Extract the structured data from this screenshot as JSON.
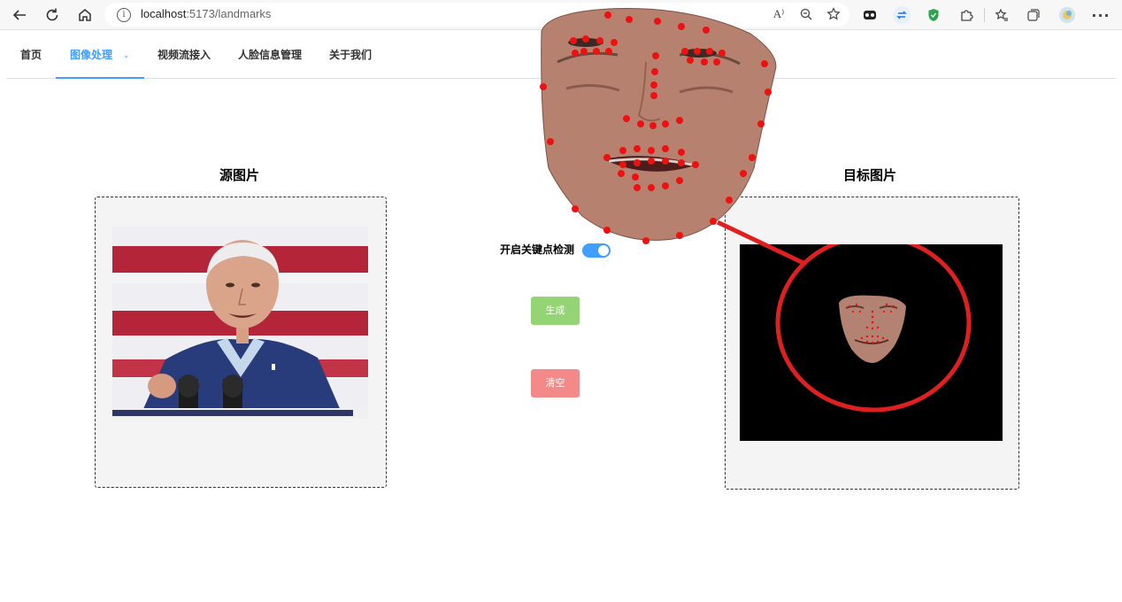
{
  "browser": {
    "url_host": "localhost",
    "url_path": ":5173/landmarks",
    "icons": [
      "back-arrow-icon",
      "reload-icon",
      "home-icon",
      "info-icon",
      "read-aloud-icon",
      "zoom-icon",
      "favorite-star-icon",
      "extension-icon",
      "sync-icon",
      "shield-icon",
      "puzzle-icon",
      "favorites-icon",
      "collections-icon",
      "profile-icon",
      "more-icon"
    ],
    "read_aloud_label": "A⁾"
  },
  "menu": {
    "items": [
      {
        "label": "首页"
      },
      {
        "label": "图像处理"
      },
      {
        "label": "视频流接入"
      },
      {
        "label": "人脸信息管理"
      },
      {
        "label": "关于我们"
      }
    ],
    "active_index": 1
  },
  "source": {
    "title": "源图片"
  },
  "target": {
    "title": "目标图片"
  },
  "controls": {
    "switch_label": "开启关键点检测",
    "switch_on": true,
    "generate_label": "生成",
    "clear_label": "清空"
  },
  "colors": {
    "accent": "#409eff",
    "generate": "#95d475",
    "clear": "#f38989",
    "highlight": "#e02020"
  }
}
